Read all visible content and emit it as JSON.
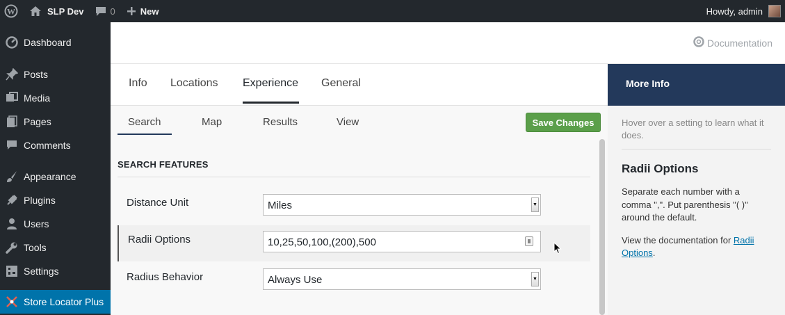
{
  "admin_bar": {
    "site_name": "SLP Dev",
    "comments_count": "0",
    "new_label": "New",
    "greeting": "Howdy, admin"
  },
  "sidebar": {
    "items": [
      {
        "label": "Dashboard",
        "icon": "dashboard-icon"
      },
      {
        "label": "Posts",
        "icon": "pin-icon"
      },
      {
        "label": "Media",
        "icon": "media-icon"
      },
      {
        "label": "Pages",
        "icon": "pages-icon"
      },
      {
        "label": "Comments",
        "icon": "comments-icon"
      },
      {
        "label": "Appearance",
        "icon": "brush-icon"
      },
      {
        "label": "Plugins",
        "icon": "plugin-icon"
      },
      {
        "label": "Users",
        "icon": "user-icon"
      },
      {
        "label": "Tools",
        "icon": "wrench-icon"
      },
      {
        "label": "Settings",
        "icon": "settings-icon"
      },
      {
        "label": "Store Locator Plus",
        "icon": "store-locator-icon"
      }
    ]
  },
  "header": {
    "documentation_label": "Documentation"
  },
  "tabs": [
    "Info",
    "Locations",
    "Experience",
    "General"
  ],
  "active_tab": "Experience",
  "subtabs": [
    "Search",
    "Map",
    "Results",
    "View"
  ],
  "active_subtab": "Search",
  "save_button": "Save Changes",
  "section_title": "SEARCH FEATURES",
  "settings": {
    "distance_unit": {
      "label": "Distance Unit",
      "value": "Miles"
    },
    "radii_options": {
      "label": "Radii Options",
      "value": "10,25,50,100,(200),500"
    },
    "radius_behavior": {
      "label": "Radius Behavior",
      "value": "Always Use"
    }
  },
  "more_info": {
    "title": "More Info",
    "hint": "Hover over a setting to learn what it does.",
    "heading": "Radii Options",
    "description": "Separate each number with a comma \",\". Put parenthesis \"( )\" around the default.",
    "doc_prefix": "View the documentation for ",
    "doc_link": "Radii Options",
    "doc_suffix": "."
  },
  "colors": {
    "admin_dark": "#23282d",
    "active_menu": "#0073aa",
    "info_header": "#23395b",
    "save_green": "#5b9f4a"
  }
}
